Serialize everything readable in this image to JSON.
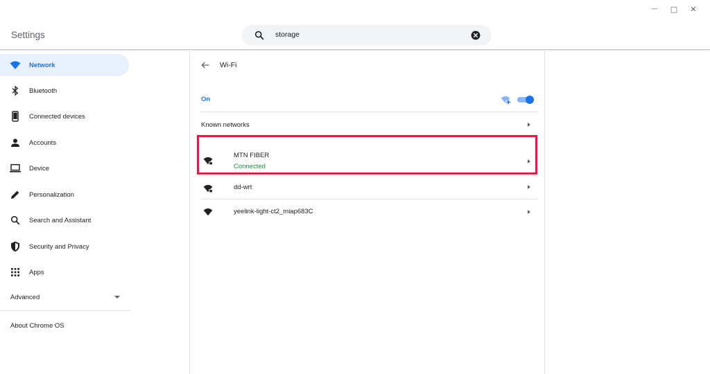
{
  "window": {
    "minimize_glyph": "—",
    "maximize_glyph": "□",
    "close_glyph": "✕"
  },
  "header": {
    "title": "Settings",
    "search": {
      "value": "storage",
      "icon": "search-icon",
      "clear_icon": "clear-icon"
    }
  },
  "sidebar": {
    "items": [
      {
        "label": "Network",
        "icon": "wifi-icon",
        "active": true
      },
      {
        "label": "Bluetooth",
        "icon": "bluetooth-icon"
      },
      {
        "label": "Connected devices",
        "icon": "phone-icon"
      },
      {
        "label": "Accounts",
        "icon": "person-icon"
      },
      {
        "label": "Device",
        "icon": "laptop-icon"
      },
      {
        "label": "Personalization",
        "icon": "pencil-icon"
      },
      {
        "label": "Search and Assistant",
        "icon": "search-icon"
      },
      {
        "label": "Security and Privacy",
        "icon": "shield-icon"
      },
      {
        "label": "Apps",
        "icon": "apps-grid-icon"
      }
    ],
    "advanced_label": "Advanced",
    "about_label": "About Chrome OS"
  },
  "main": {
    "page_title": "Wi-Fi",
    "wifi_state_label": "On",
    "wifi_enabled": true,
    "known_networks_label": "Known networks",
    "networks": [
      {
        "name": "MTN FIBER",
        "status": "Connected",
        "secured": true
      },
      {
        "name": "dd-wrt",
        "status": "",
        "secured": true
      },
      {
        "name": "yeelink-light-ct2_miap683C",
        "status": "",
        "secured": false
      }
    ]
  },
  "colors": {
    "accent": "#1a73e8",
    "active_bg": "#e8f0fe",
    "connected": "#1e8e3e",
    "highlight": "#e8184a"
  }
}
